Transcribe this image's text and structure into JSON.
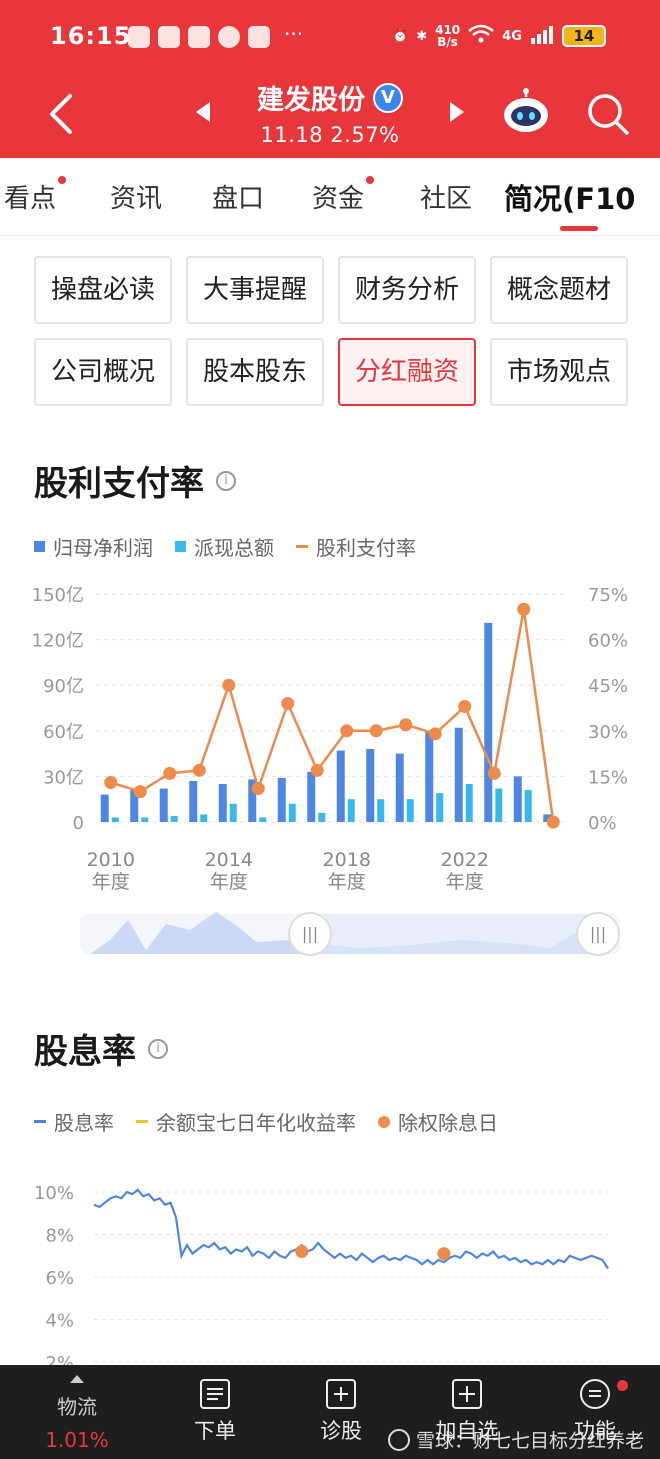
{
  "status_bar": {
    "time": "16:15",
    "net_speed_value": "410",
    "net_speed_unit": "B/s",
    "network": "4G",
    "battery": "14"
  },
  "header": {
    "stock_name": "建发股份",
    "verify_mark": "V",
    "price": "11.18",
    "change_pct": "2.57%"
  },
  "tabs": [
    {
      "label": "看点",
      "dot": true
    },
    {
      "label": "资讯",
      "dot": false
    },
    {
      "label": "盘口",
      "dot": false
    },
    {
      "label": "资金",
      "dot": true
    },
    {
      "label": "社区",
      "dot": false
    },
    {
      "label": "简况(F10",
      "dot": false,
      "active": true
    }
  ],
  "grid_buttons": [
    {
      "label": "操盘必读",
      "selected": false
    },
    {
      "label": "大事提醒",
      "selected": false
    },
    {
      "label": "财务分析",
      "selected": false
    },
    {
      "label": "概念题材",
      "selected": false
    },
    {
      "label": "公司概况",
      "selected": false
    },
    {
      "label": "股本股东",
      "selected": false
    },
    {
      "label": "分红融资",
      "selected": true
    },
    {
      "label": "市场观点",
      "selected": false
    }
  ],
  "section1": {
    "title": "股利支付率",
    "info_icon": "i",
    "legend": [
      {
        "label": "归母净利润",
        "color": "#4e86e4"
      },
      {
        "label": "派现总额",
        "color": "#38b8ec"
      },
      {
        "label": "股利支付率",
        "color": "#ee8a4a"
      }
    ]
  },
  "section2": {
    "title": "股息率",
    "info_icon": "i",
    "legend": [
      {
        "label": "股息率",
        "color": "#4e86e4"
      },
      {
        "label": "余额宝七日年化收益率",
        "color": "#f2c12e"
      },
      {
        "label": "除权除息日",
        "color": "#ee8a4a"
      }
    ]
  },
  "chart_data": [
    {
      "type": "bar",
      "title": "股利支付率",
      "categories": [
        "2010年度",
        "2011年度",
        "2012年度",
        "2013年度",
        "2014年度",
        "2015年度",
        "2016年度",
        "2017年度",
        "2018年度",
        "2019年度",
        "2020年度",
        "2021年度",
        "2022年度",
        "2023年度",
        "2024年度",
        "2025年度"
      ],
      "x_tick_labels": [
        {
          "year": "2010",
          "suffix": "年度",
          "index": 0
        },
        {
          "year": "2014",
          "suffix": "年度",
          "index": 4
        },
        {
          "year": "2018",
          "suffix": "年度",
          "index": 8
        },
        {
          "year": "2022",
          "suffix": "年度",
          "index": 12
        }
      ],
      "y_left_ticks": [
        "0",
        "30亿",
        "60亿",
        "90亿",
        "120亿",
        "150亿"
      ],
      "y_right_ticks": [
        "0%",
        "15%",
        "30%",
        "45%",
        "60%",
        "75%"
      ],
      "ylim_left": [
        0,
        150
      ],
      "ylim_right": [
        0,
        75
      ],
      "series": [
        {
          "name": "归母净利润",
          "unit": "亿",
          "values": [
            18,
            21,
            22,
            27,
            25,
            28,
            29,
            33,
            47,
            48,
            45,
            60,
            62,
            131,
            30,
            5
          ]
        },
        {
          "name": "派现总额",
          "unit": "亿",
          "values": [
            3,
            3,
            4,
            5,
            12,
            3,
            12,
            6,
            15,
            15,
            15,
            19,
            25,
            22,
            21,
            0
          ]
        },
        {
          "name": "股利支付率",
          "unit": "%",
          "axis": "right",
          "values": [
            13,
            10,
            16,
            17,
            45,
            11,
            39,
            17,
            30,
            30,
            32,
            29,
            38,
            16,
            70,
            0
          ]
        }
      ],
      "grid": true,
      "legend_position": "top-left"
    },
    {
      "type": "line",
      "title": "股息率",
      "y_ticks": [
        "2%",
        "4%",
        "6%",
        "8%",
        "10%"
      ],
      "ylim": [
        2,
        10.5
      ],
      "series": [
        {
          "name": "股息率",
          "unit": "%",
          "values": [
            9.4,
            9.3,
            9.5,
            9.7,
            9.8,
            9.7,
            10.0,
            9.9,
            10.1,
            9.8,
            9.9,
            9.6,
            9.7,
            9.4,
            9.5,
            8.8,
            7.0,
            7.5,
            7.1,
            7.3,
            7.5,
            7.4,
            7.6,
            7.3,
            7.4,
            7.1,
            7.3,
            7.2,
            7.4,
            7.0,
            7.2,
            7.1,
            6.9,
            7.2,
            7.0,
            6.9,
            7.2,
            7.3,
            7.5,
            7.2,
            7.3,
            7.6,
            7.3,
            7.1,
            6.9,
            7.1,
            6.9,
            7.0,
            6.8,
            7.1,
            6.9,
            6.7,
            6.9,
            7.0,
            6.8,
            6.9,
            6.8,
            7.0,
            6.9,
            6.8,
            6.6,
            6.8,
            6.6,
            6.8,
            6.7,
            6.9,
            7.0,
            6.9,
            7.2,
            7.1,
            6.9,
            7.1,
            7.0,
            7.2,
            6.9,
            7.0,
            6.8,
            6.9,
            6.7,
            6.8,
            6.6,
            6.7,
            6.6,
            6.8,
            6.6,
            6.8,
            6.7,
            7.0,
            6.9,
            6.8,
            6.9,
            7.0,
            6.9,
            6.8,
            6.4
          ]
        },
        {
          "name": "除权除息日",
          "type": "marker",
          "points": [
            {
              "index": 38,
              "value": 7.2
            },
            {
              "index": 64,
              "value": 7.1
            }
          ]
        }
      ],
      "grid": true,
      "legend_position": "top-left"
    }
  ],
  "bottom_bar": {
    "wuliu_label": "物流",
    "wuliu_pct": "1.01%",
    "items": [
      {
        "label": "下单"
      },
      {
        "label": "诊股"
      },
      {
        "label": "加自选"
      },
      {
        "label": "功能"
      }
    ],
    "watermark": "雪球：财七七目标分红养老"
  },
  "colors": {
    "brand_red": "#e8363b",
    "bar_profit": "#4e86e4",
    "bar_dividend": "#38b8ec",
    "payout_line": "#ee8a4a",
    "yield_line": "#4e86e4"
  }
}
